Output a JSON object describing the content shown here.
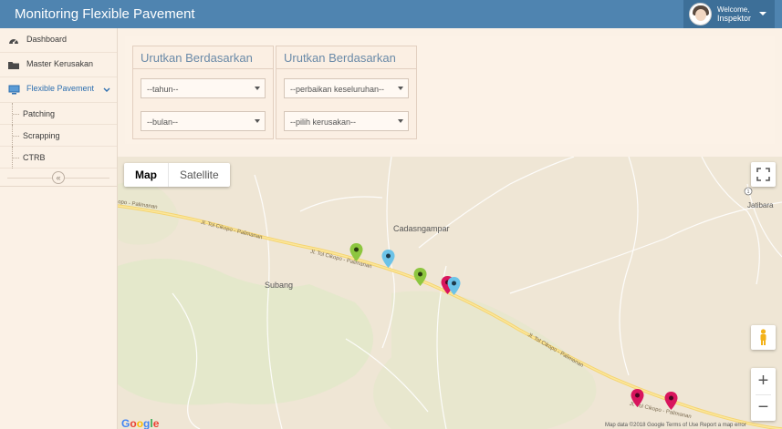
{
  "header": {
    "title": "Monitoring Flexible Pavement",
    "welcome": "Welcome,",
    "username": "Inspektor"
  },
  "sidebar": {
    "items": [
      {
        "label": "Dashboard",
        "icon": "dashboard-icon"
      },
      {
        "label": "Master Kerusakan",
        "icon": "folder-icon"
      },
      {
        "label": "Flexible Pavement",
        "icon": "monitor-icon",
        "expanded": true
      }
    ],
    "subitems": [
      {
        "label": "Patching"
      },
      {
        "label": "Scrapping"
      },
      {
        "label": "CTRB"
      }
    ],
    "collapse_symbol": "«"
  },
  "filters": {
    "panel1": {
      "title": "Urutkan Berdasarkan",
      "year_select": "--tahun--",
      "month_select": "--bulan--"
    },
    "panel2": {
      "title": "Urutkan Berdasarkan",
      "repair_select": "--perbaikan keseluruhan--",
      "damage_select": "--pilih kerusakan--"
    }
  },
  "map": {
    "type_buttons": {
      "map": "Map",
      "satellite": "Satellite"
    },
    "places": {
      "cadasngampar": "Cadasngampar",
      "subang": "Subang",
      "jatibara": "Jatibara"
    },
    "road_labels": {
      "left": "opo - Palimanan",
      "mid1": "Jl. Tol Cikopo - Palimanan",
      "mid2": "Jl. Tol Cikopo - Palimanan",
      "lower": "Jl. Tol Cikopo - Palimanan",
      "bottom": "Jl. Tol Cikopo - Palimanan"
    },
    "zoom_in": "+",
    "zoom_out": "−",
    "google": "Google",
    "attribution": "Map data ©2018 Google   Terms of Use   Report a map error",
    "marker_colors": {
      "green": "#8dc63f",
      "blue": "#6cc3e8",
      "pink": "#d8155d"
    }
  }
}
